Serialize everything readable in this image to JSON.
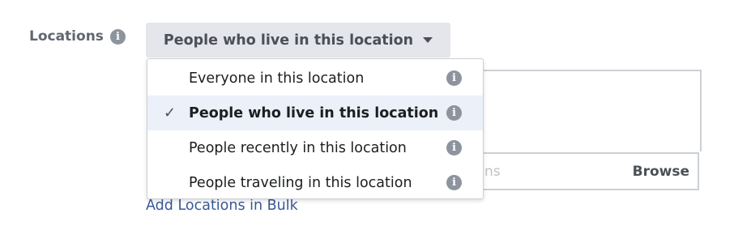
{
  "locations": {
    "label": "Locations",
    "label_info_icon": "info-icon",
    "dropdown": {
      "selected": "People who live in this location",
      "caret_icon": "caret-down-icon"
    },
    "options": [
      {
        "label": "Everyone in this location",
        "selected": false
      },
      {
        "label": "People who live in this location",
        "selected": true
      },
      {
        "label": "People recently in this location",
        "selected": false
      },
      {
        "label": "People traveling in this location",
        "selected": false
      }
    ],
    "check_glyph": "✓",
    "bulk_input": {
      "placeholder_fragment": "ns",
      "browse_label": "Browse"
    },
    "add_bulk_link": "Add Locations in Bulk"
  },
  "colors": {
    "label_gray": "#606770",
    "button_bg": "#e4e6eb",
    "link_blue": "#385898",
    "selected_row_bg": "#ebf0f9",
    "icon_gray": "#8d949e"
  }
}
